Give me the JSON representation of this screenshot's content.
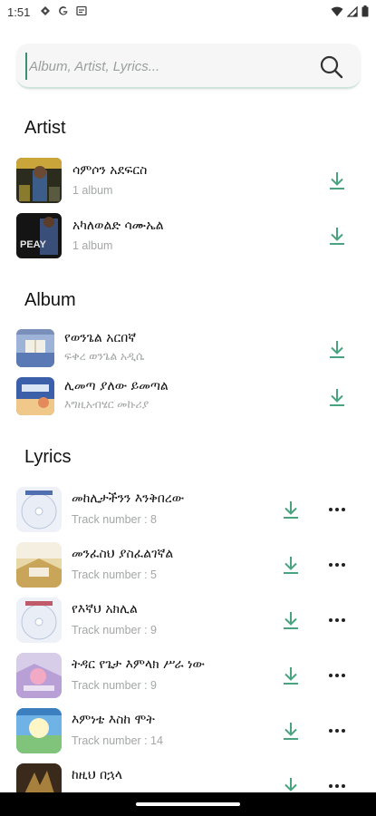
{
  "status_bar": {
    "time": "1:51"
  },
  "search": {
    "placeholder": "Album, Artist, Lyrics..."
  },
  "sections": {
    "artist": "Artist",
    "album": "Album",
    "lyrics": "Lyrics"
  },
  "artists": [
    {
      "name": "ሳምሶን አደፍርስ",
      "sub": "1 album"
    },
    {
      "name": "አካለወልድ ሳሙኤል",
      "sub": "1 album"
    }
  ],
  "albums": [
    {
      "name": "የወንጌል አርበኛ",
      "sub": "ፍቅረ ወንጌል አዲሴ"
    },
    {
      "name": "ሊመጣ ያለው ይመጣል",
      "sub": "እግዚአብሄር መኩሪያ"
    }
  ],
  "lyrics": [
    {
      "name": "መከሊታችንን እንቅበረው",
      "sub": "Track number : 8"
    },
    {
      "name": "መንፈስህ ያስፈልገኛል",
      "sub": "Track number : 5"
    },
    {
      "name": "የእኛህ አክሊል",
      "sub": "Track number : 9"
    },
    {
      "name": "ትዳር የጌታ እምላክ ሥራ ነው",
      "sub": "Track number : 9"
    },
    {
      "name": "እምነቴ እስከ ሞት",
      "sub": "Track number : 14"
    },
    {
      "name": "ከዚህ በኋላ",
      "sub": ""
    }
  ],
  "colors": {
    "accent": "#4aa37f",
    "muted": "#a3a7a5"
  }
}
